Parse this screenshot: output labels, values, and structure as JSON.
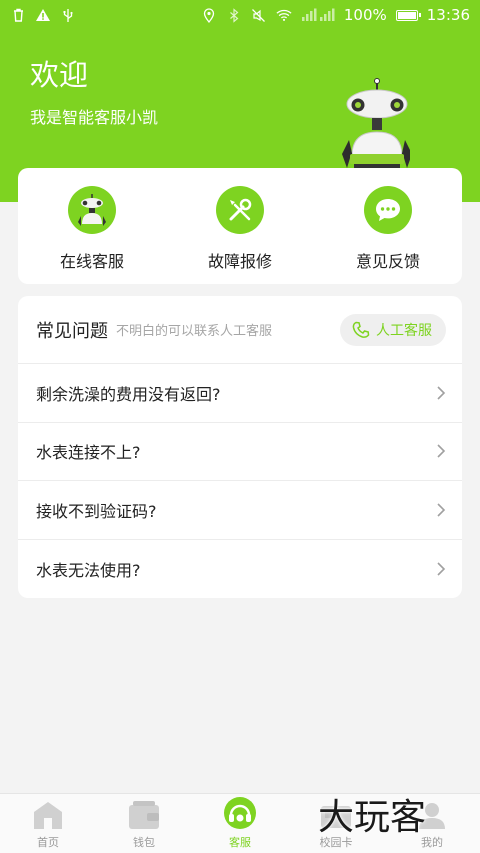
{
  "status_bar": {
    "battery": "100%",
    "time": "13:36",
    "battery_level": 1.0,
    "icons_left": [
      "trash-icon",
      "warning-icon",
      "usb-icon"
    ],
    "icons_right": [
      "location-icon",
      "bluetooth-icon",
      "mute-icon",
      "wifi-icon",
      "signal-icon"
    ]
  },
  "header": {
    "title": "欢迎",
    "subtitle": "我是智能客服小凯"
  },
  "services": [
    {
      "label": "在线客服",
      "icon": "robot-icon"
    },
    {
      "label": "故障报修",
      "icon": "tools-icon"
    },
    {
      "label": "意见反馈",
      "icon": "chat-bubble-icon"
    }
  ],
  "faq": {
    "title": "常见问题",
    "hint": "不明白的可以联系人工客服",
    "contact_button": "人工客服",
    "questions": [
      "剩余洗澡的费用没有返回?",
      "水表连接不上?",
      "接收不到验证码?",
      "水表无法使用?"
    ]
  },
  "tabbar": {
    "tabs": [
      {
        "label": "首页",
        "active": false
      },
      {
        "label": "钱包",
        "active": false
      },
      {
        "label": "客服",
        "active": true
      },
      {
        "label": "校园卡",
        "active": false
      },
      {
        "label": "我的",
        "active": false
      }
    ]
  },
  "watermark": "大玩客",
  "colors": {
    "accent": "#7ed321",
    "background": "#f3f3f3",
    "card": "#ffffff",
    "text": "#222222",
    "muted": "#a6a6a6"
  }
}
